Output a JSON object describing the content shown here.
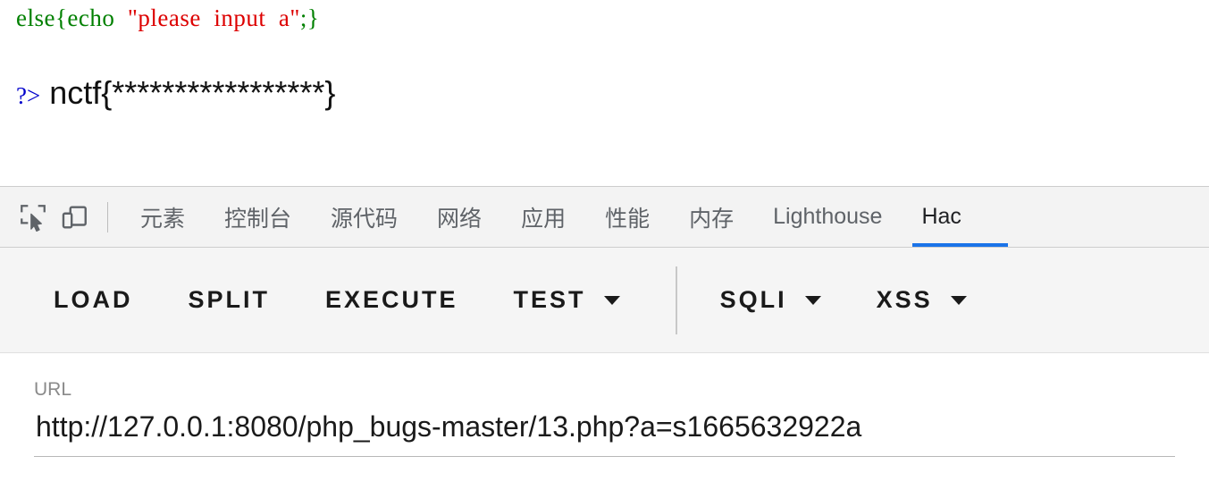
{
  "page_content": {
    "code_line": {
      "segment_1": "else{echo",
      "segment_2": "  \"please  input  a\"",
      "segment_3": ";}"
    },
    "flag_line": {
      "php_close_tag": "?>",
      "flag": "nctf{*****************}"
    }
  },
  "devtools": {
    "icons": {
      "inspect": "inspect-element-icon",
      "device": "device-toolbar-icon"
    },
    "tabs": [
      {
        "label": "元素",
        "name": "elements",
        "active": false
      },
      {
        "label": "控制台",
        "name": "console",
        "active": false
      },
      {
        "label": "源代码",
        "name": "sources",
        "active": false
      },
      {
        "label": "网络",
        "name": "network",
        "active": false
      },
      {
        "label": "应用",
        "name": "application",
        "active": false
      },
      {
        "label": "性能",
        "name": "performance",
        "active": false
      },
      {
        "label": "内存",
        "name": "memory",
        "active": false
      },
      {
        "label": "Lighthouse",
        "name": "lighthouse",
        "active": false
      },
      {
        "label": "Hac",
        "name": "hackbar",
        "active": true
      }
    ],
    "accent_color": "#1a73e8"
  },
  "hackbar": {
    "buttons": [
      {
        "label": "LOAD",
        "name": "load",
        "caret": false
      },
      {
        "label": "SPLIT",
        "name": "split",
        "caret": false
      },
      {
        "label": "EXECUTE",
        "name": "execute",
        "caret": false
      },
      {
        "label": "TEST",
        "name": "test",
        "caret": true
      }
    ],
    "buttons_right": [
      {
        "label": "SQLI",
        "name": "sqli",
        "caret": true
      },
      {
        "label": "XSS",
        "name": "xss",
        "caret": true
      }
    ],
    "url_field": {
      "label": "URL",
      "value": "http://127.0.0.1:8080/php_bugs-master/13.php?a=s1665632922a",
      "placeholder": "URL"
    }
  }
}
